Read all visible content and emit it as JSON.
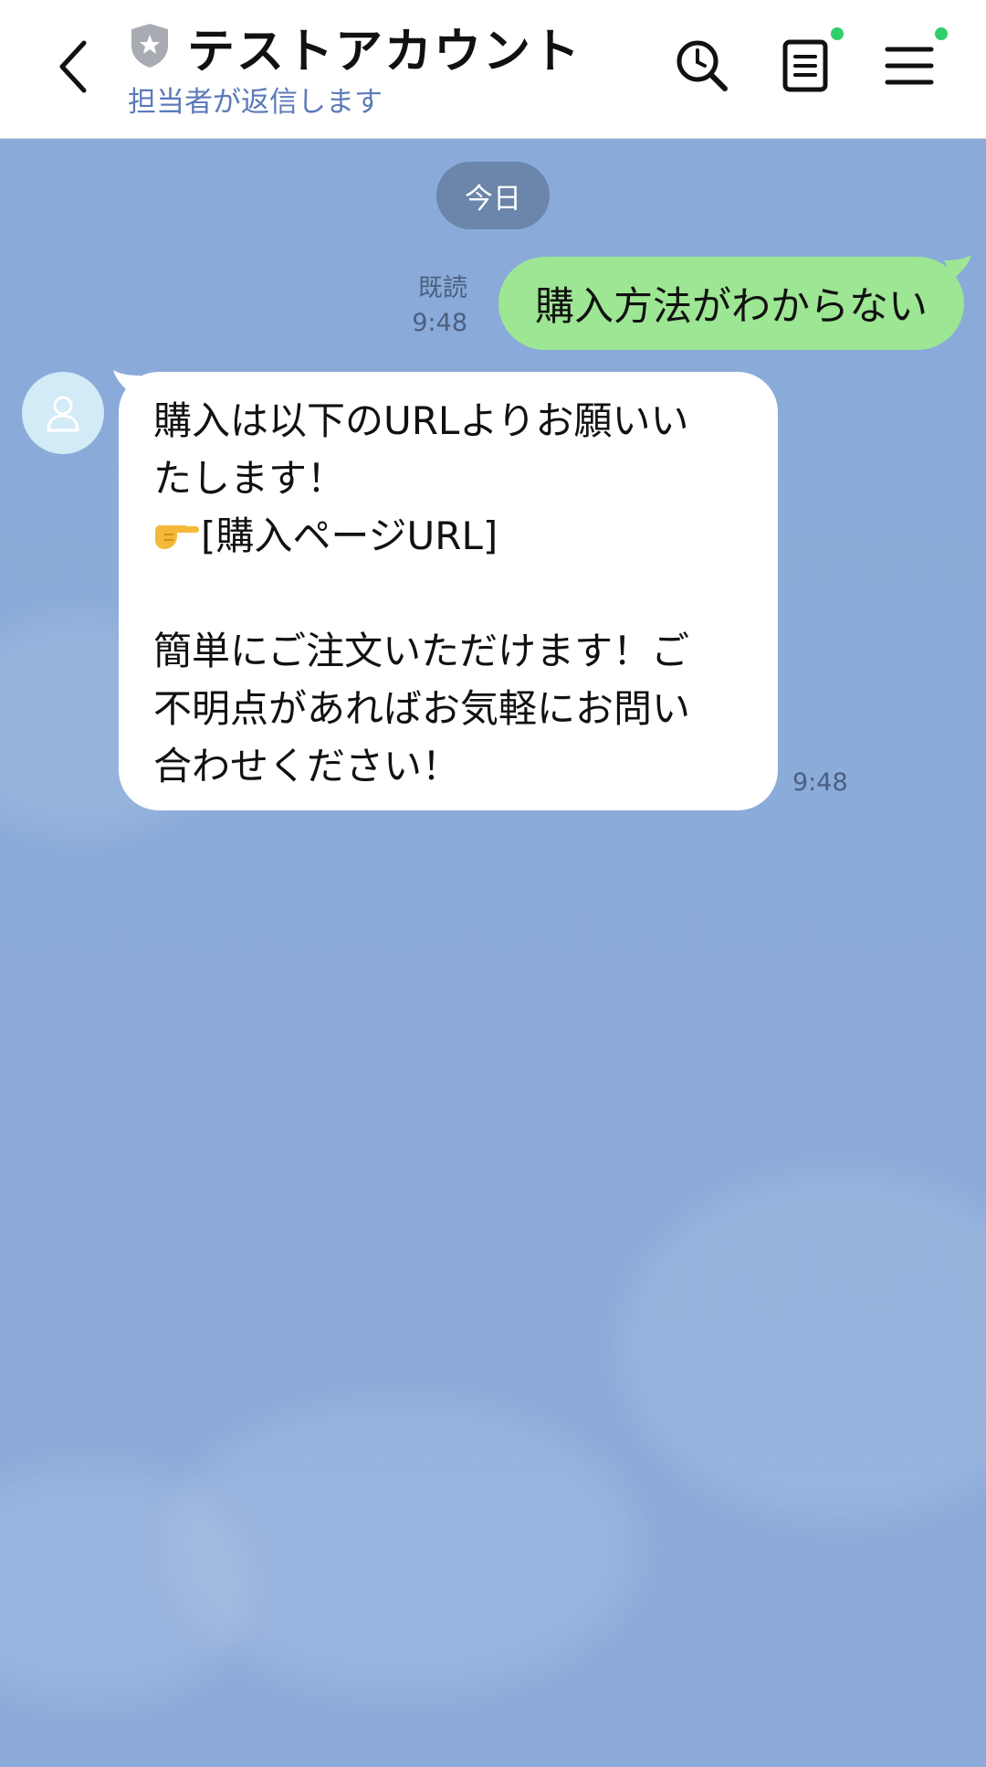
{
  "header": {
    "title": "テストアカウント",
    "subtitle": "担当者が返信します"
  },
  "icons": {
    "back": "chevron-left-icon",
    "badge": "shield-star-icon",
    "search": "clock-search-icon",
    "notes": "notes-icon",
    "menu": "hamburger-menu-icon",
    "avatar": "person-icon",
    "pointer": "pointing-hand-emoji"
  },
  "chat": {
    "date_chip": "今日",
    "sent_message": {
      "text": "購入方法がわからない",
      "read_label": "既読",
      "time": "9:48"
    },
    "received_message": {
      "line1": "購入は以下のURLよりお願いい",
      "line2": "たします！",
      "line3": "[購入ページURL]",
      "line4": "簡単にご注文いただけます！ご",
      "line5": "不明点があればお気軽にお問い",
      "line6": "合わせください！",
      "time": "9:48"
    }
  },
  "colors": {
    "header_bg": "#ffffff",
    "chat_bg": "#8cabd9",
    "sent_bubble": "#9de693",
    "received_bubble": "#ffffff",
    "date_chip": "#6b85ab",
    "subtitle": "#5c7ab8",
    "notification_dot": "#2fcf6b"
  }
}
